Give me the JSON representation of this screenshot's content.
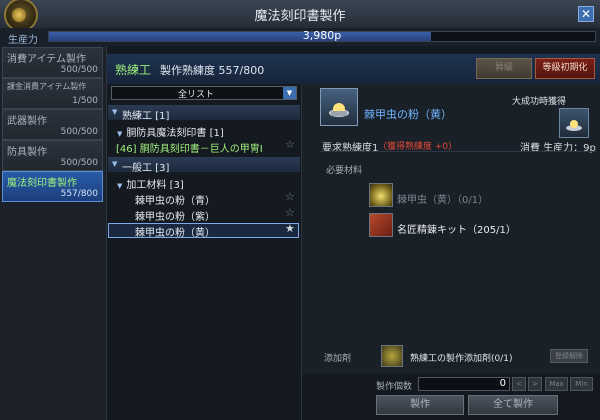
{
  "window": {
    "title": "魔法刻印書製作",
    "close_label": "✕"
  },
  "productivity": {
    "label": "生産力",
    "value": "3,980p",
    "fill_fraction": 0.7
  },
  "sidebar": {
    "items": [
      {
        "label": "消費アイテム製作",
        "count": "500/500",
        "selected": false
      },
      {
        "label": "課金消費アイテム製作",
        "count": "1/500",
        "selected": false
      },
      {
        "label": "武器製作",
        "count": "500/500",
        "selected": false
      },
      {
        "label": "防具製作",
        "count": "500/500",
        "selected": false
      },
      {
        "label": "魔法刻印書製作",
        "count": "557/800",
        "selected": true
      }
    ]
  },
  "header": {
    "skill_name": "熟練工",
    "proficiency": "製作熟練度 557/800",
    "upgrade_button": "昇級",
    "reset_button": "等級初期化"
  },
  "list": {
    "dropdown": "全リスト",
    "groups": [
      {
        "label": "熟練工 [1]",
        "subgroups": [
          {
            "label": "胴防具魔法刻印書 [1]",
            "recipes": [
              "[46] 胴防具刻印書－巨人の甲冑Ⅰ"
            ]
          }
        ]
      },
      {
        "label": "一般工 [3]",
        "subgroups": [
          {
            "label": "加工材料 [3]",
            "items": [
              "棘甲虫の粉（青）",
              "棘甲虫の粉（紫）",
              "棘甲虫の粉（黄）"
            ]
          }
        ]
      }
    ]
  },
  "detail": {
    "item_name": "棘甲虫の粉（黄）",
    "great_success_label": "大成功時獲得",
    "required_label": "要求熟練度1",
    "required_bonus": "（獲得熟練度 +0）",
    "consume_label": "消費 生産力：9p",
    "materials_heading": "必要材料",
    "materials": [
      {
        "name": "棘甲虫（黄）（0/1）",
        "available": false
      },
      {
        "name": "名匠精錬キット（205/1）",
        "available": true
      }
    ],
    "additive_label": "添加剤",
    "additive_name": "熟練工の製作添加剤(0/1)",
    "additive_button": "登録解除",
    "count_label": "製作個数",
    "count_value": "0",
    "small_buttons": [
      "<",
      ">",
      "Max",
      "Min"
    ],
    "craft_button": "製作",
    "craft_all_button": "全て製作"
  },
  "colors": {
    "accent_green": "#9ff07d",
    "item_blue": "#6fb4ff",
    "warning_red": "#e24a3a",
    "selected_blue": "#2a5ca8"
  }
}
